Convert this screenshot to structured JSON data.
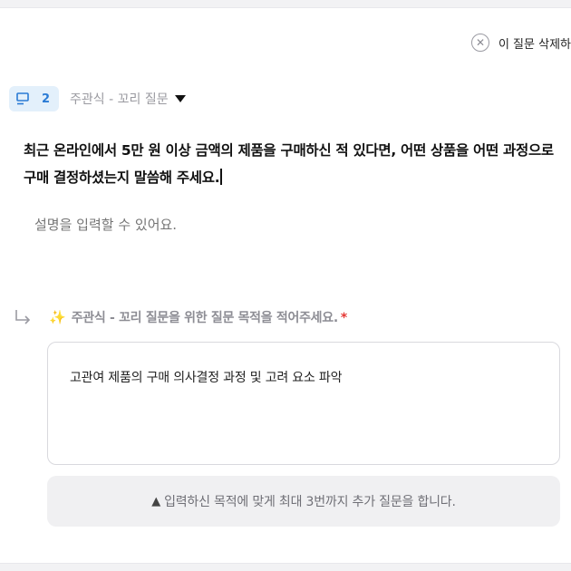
{
  "header": {
    "delete_label": "이 질문 삭제하",
    "delete_icon": "close-circle-icon"
  },
  "question": {
    "number": "2",
    "type_label": "주관식 - 꼬리 질문",
    "text": "최근 온라인에서 5만 원 이상 금액의 제품을 구매하신 적 있다면, 어떤 상품을 어떤 과정으로 구매 결정하셨는지 말씀해 주세요.",
    "description_placeholder": "설명을 입력할 수 있어요."
  },
  "followup": {
    "sparkle_icon": "✨",
    "label": "주관식 - 꼬리 질문을 위한 질문 목적을 적어주세요.",
    "required_mark": "*",
    "purpose_value": "고관여 제품의 구매 의사결정 과정 및 고려 요소 파악",
    "notice_icon": "▲",
    "notice": "입력하신 목적에 맞게 최대 3번까지 추가 질문을 합니다."
  },
  "colors": {
    "accent": "#2a7bd5",
    "badge_bg": "#e3f0fb",
    "required": "#e53935",
    "sparkle": "#f5a623"
  }
}
